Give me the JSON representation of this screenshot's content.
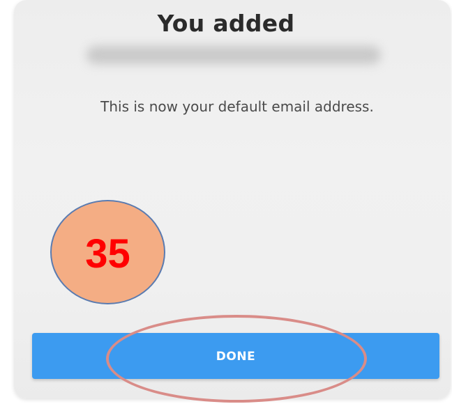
{
  "dialog": {
    "title": "You added",
    "email_redacted": "",
    "message": "This is now your default email address.",
    "done_label": "DONE"
  },
  "annotation": {
    "step_number": "35",
    "badge_color": "#f4ad84",
    "number_color": "#ff0000",
    "ring_color": "#d98c88"
  },
  "colors": {
    "button": "#3c9bf0",
    "card": "#efefef",
    "title": "#2b2b2b"
  }
}
